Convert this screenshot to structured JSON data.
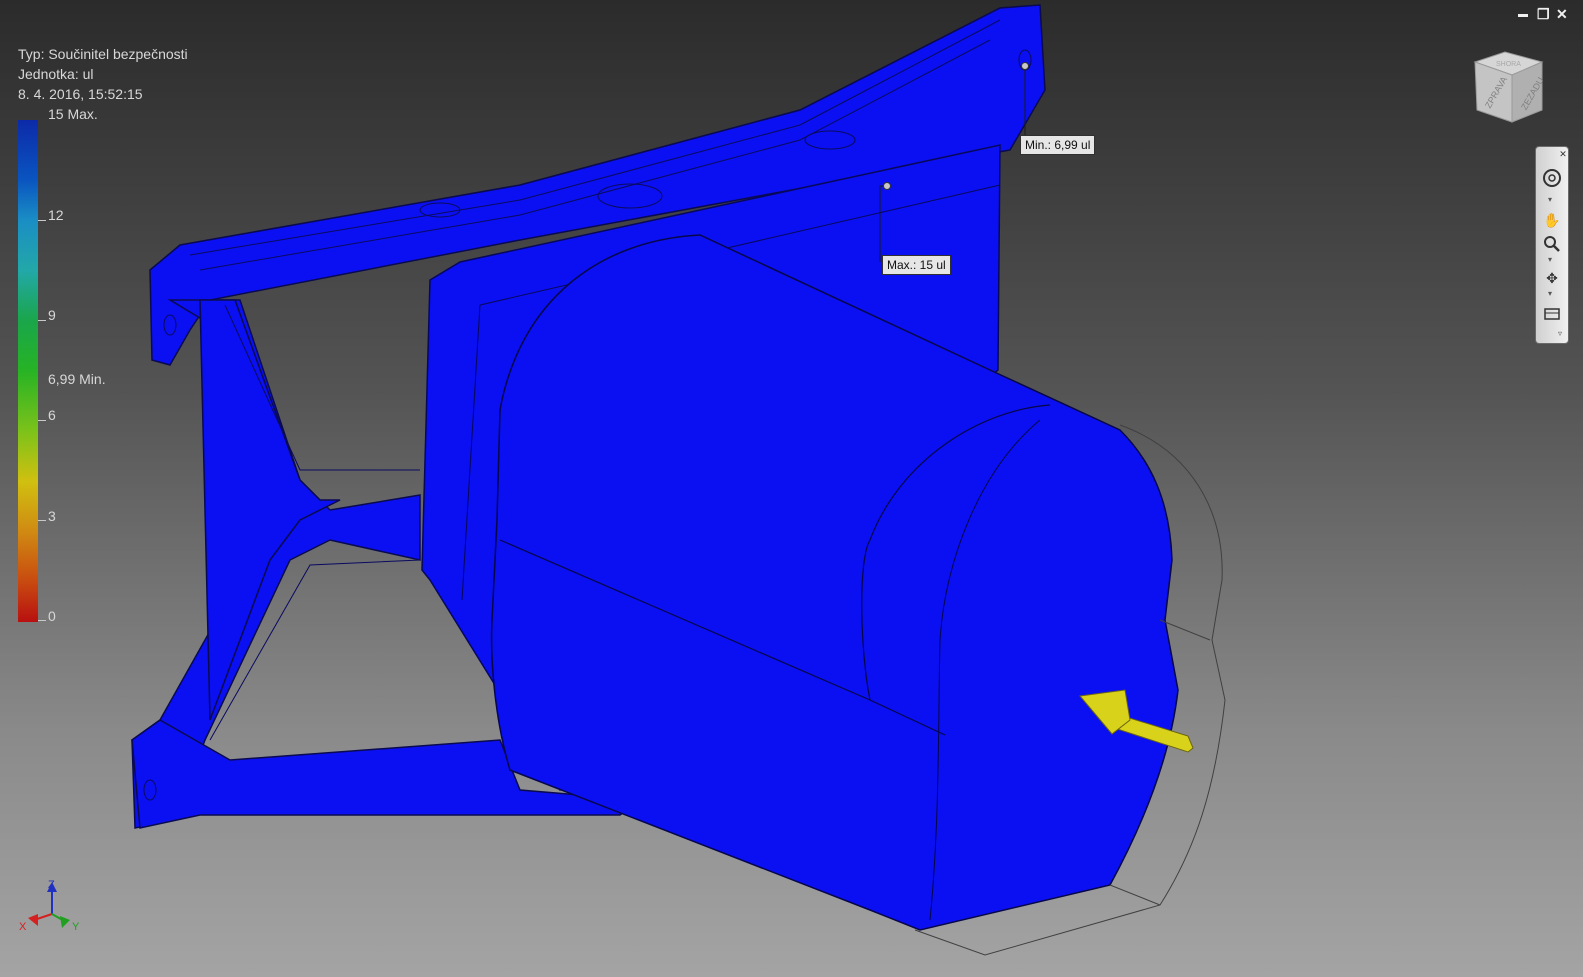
{
  "result_info": {
    "type_line": "Typ: Součinitel bezpečnosti",
    "unit_line": "Jednotka: ul",
    "date_line": "8. 4. 2016, 15:52:15"
  },
  "legend": {
    "max_label": "15 Max.",
    "min_label": "6,99 Min.",
    "ticks": [
      {
        "label": "12",
        "value": 12
      },
      {
        "label": "9",
        "value": 9
      },
      {
        "label": "6",
        "value": 6
      },
      {
        "label": "3",
        "value": 3
      },
      {
        "label": "0",
        "value": 0
      }
    ],
    "min_value": 6.99,
    "max_value": 15
  },
  "probes": {
    "min_text": "Min.: 6,99 ul",
    "max_text": "Max.: 15 ul"
  },
  "viewcube": {
    "face_left": "ZPRAVA",
    "face_right": "ZEZADU",
    "face_top": "SHORA"
  },
  "axes": {
    "x": "X",
    "y": "Y",
    "z": "Z"
  },
  "colors": {
    "model": "#0a10f2",
    "load_arrow": "#d9d21a",
    "axis_x": "#d42020",
    "axis_y": "#20a020",
    "axis_z": "#2030c0"
  },
  "window_controls": {
    "minimize": "▬",
    "restore": "❐",
    "close": "✕"
  }
}
